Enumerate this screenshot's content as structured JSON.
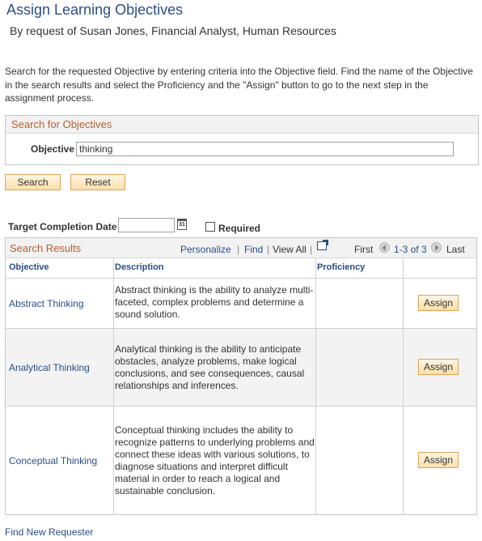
{
  "page": {
    "title": "Assign Learning Objectives",
    "subtitle": "By request of Susan Jones, Financial Analyst, Human Resources",
    "instructions": "Search for the requested Objective by entering criteria into the Objective field. Find the name of the Objective in the search results and select the Proficiency and the \"Assign\" button to go to the next step in the assignment process."
  },
  "search_panel": {
    "header": "Search for Objectives",
    "objective_label": "Objective",
    "objective_value": "thinking"
  },
  "buttons": {
    "search": "Search",
    "reset": "Reset"
  },
  "completion": {
    "label": "Target Completion Date",
    "value": "",
    "calendar_glyph": "31",
    "required_label": "Required",
    "required_checked": false
  },
  "results": {
    "title": "Search Results",
    "personalize": "Personalize",
    "find": "Find",
    "view_all": "View All",
    "first": "First",
    "range": "1-3 of 3",
    "last": "Last",
    "columns": [
      "Objective",
      "Description",
      "Proficiency"
    ],
    "rows": [
      {
        "objective": "Abstract Thinking",
        "description": "Abstract thinking is the ability to analyze multi-faceted, complex problems and determine a sound solution.",
        "proficiency": "",
        "action": "Assign"
      },
      {
        "objective": "Analytical Thinking",
        "description": "Analytical thinking is the ability to anticipate obstacles, analyze problems, make logical conclusions, and see consequences, causal relationships and inferences.",
        "proficiency": "",
        "action": "Assign"
      },
      {
        "objective": "Conceptual Thinking",
        "description": "Conceptual thinking includes the ability to recognize patterns to underlying problems and connect these ideas with various solutions, to diagnose situations and interpret difficult material in order to reach a logical and sustainable conclusion.",
        "proficiency": "",
        "action": "Assign"
      }
    ]
  },
  "footer": {
    "find_new_requester": "Find New Requester"
  }
}
